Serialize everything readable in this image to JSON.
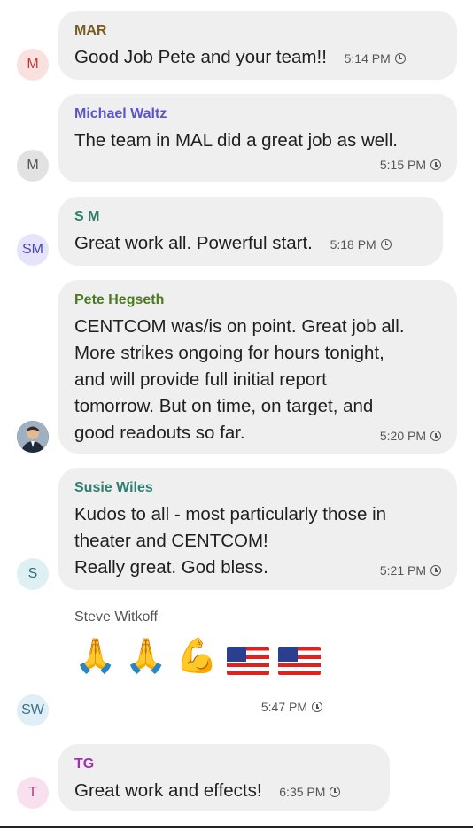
{
  "messages": [
    {
      "initials": "M",
      "sender": "MAR",
      "text": "Good Job Pete and your team!!",
      "time": "5:14 PM"
    },
    {
      "initials": "M",
      "sender": "Michael Waltz",
      "text": "The team in MAL did a great job  as well.",
      "time": "5:15 PM"
    },
    {
      "initials": "SM",
      "sender": "S M",
      "text": "Great work all. Powerful start.",
      "time": "5:18 PM"
    },
    {
      "initials": "",
      "sender": "Pete Hegseth",
      "lines": [
        "CENTCOM was/is on point. Great job all.",
        "More strikes ongoing for hours tonight,",
        "and will provide full initial report",
        "tomorrow. But on time, on target, and",
        "good readouts so far."
      ],
      "time": "5:20 PM"
    },
    {
      "initials": "S",
      "sender": "Susie Wiles",
      "lines": [
        "Kudos to all - most particularly those in",
        "theater and CENTCOM!",
        "Really great. God bless."
      ],
      "time": "5:21 PM"
    },
    {
      "initials": "SW",
      "sender": "Steve Witkoff",
      "emojis": [
        "folded-hands",
        "folded-hands",
        "flexed-biceps",
        "us-flag",
        "us-flag"
      ],
      "time": "5:47 PM"
    },
    {
      "initials": "T",
      "sender": "TG",
      "text": "Great work and effects!",
      "time": "6:35 PM"
    }
  ],
  "colors": {
    "bubble": "#efefef",
    "mar": "#7a5c1e",
    "waltz": "#5b55c7",
    "sm": "#2e7d6b",
    "hegseth": "#4a7a1f",
    "wiles": "#2d7f6f",
    "witkoff": "#555555",
    "tg": "#a032b0"
  }
}
